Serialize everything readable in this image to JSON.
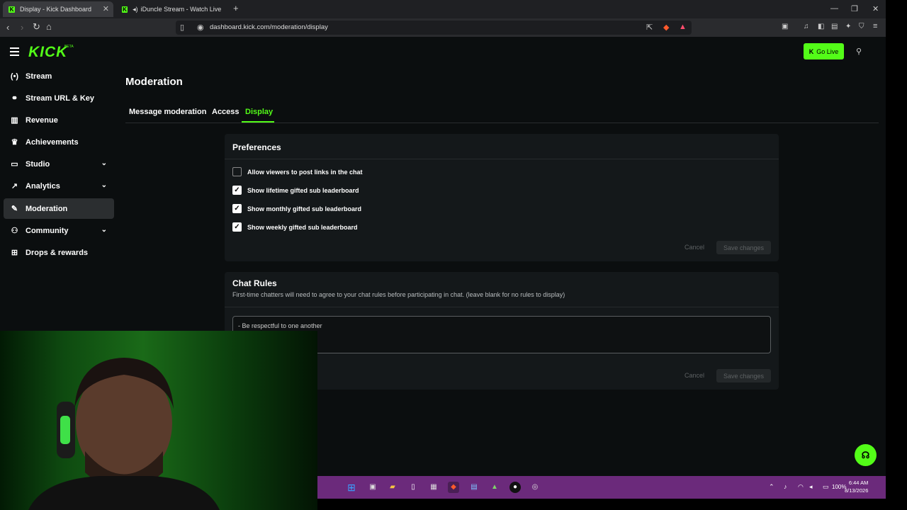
{
  "browser": {
    "tabs": [
      {
        "title": "Display - Kick Dashboard",
        "active": true
      },
      {
        "title": "iDuncle Stream - Watch Live on K",
        "active": false
      }
    ],
    "new_tab": "+",
    "url": "dashboard.kick.com/moderation/display"
  },
  "brand": {
    "logo": "KICK",
    "beta": "BETA",
    "accent": "#53fc18"
  },
  "header": {
    "go_live": "Go Live"
  },
  "sidebar": {
    "items": [
      {
        "label": "Stream",
        "icon": "broadcast-icon"
      },
      {
        "label": "Stream URL & Key",
        "icon": "link-icon"
      },
      {
        "label": "Revenue",
        "icon": "chart-icon"
      },
      {
        "label": "Achievements",
        "icon": "trophy-icon"
      },
      {
        "label": "Studio",
        "icon": "studio-icon"
      },
      {
        "label": "Analytics",
        "icon": "analytics-icon"
      },
      {
        "label": "Moderation",
        "icon": "wrench-icon",
        "active": true
      },
      {
        "label": "Community",
        "icon": "people-icon"
      },
      {
        "label": "Drops & rewards",
        "icon": "gift-icon"
      }
    ]
  },
  "main": {
    "title": "Moderation",
    "tabs": [
      {
        "label": "Message moderation"
      },
      {
        "label": "Access"
      },
      {
        "label": "Display",
        "active": true
      }
    ],
    "preferences": {
      "title": "Preferences",
      "options": [
        {
          "label": "Allow viewers to post links in the chat",
          "checked": false
        },
        {
          "label": "Show lifetime gifted sub leaderboard",
          "checked": true
        },
        {
          "label": "Show monthly gifted sub leaderboard",
          "checked": true
        },
        {
          "label": "Show weekly gifted sub leaderboard",
          "checked": true
        }
      ],
      "cancel": "Cancel",
      "save": "Save changes"
    },
    "chat_rules": {
      "title": "Chat Rules",
      "subtitle": "First-time chatters will need to agree to your chat rules before participating in chat. (leave blank for no rules to display)",
      "value": "- Be respectful to one another",
      "cancel": "Cancel",
      "save": "Save changes"
    }
  },
  "system": {
    "battery": "100%",
    "time": "6:44 AM",
    "date": "8/13/2026"
  }
}
